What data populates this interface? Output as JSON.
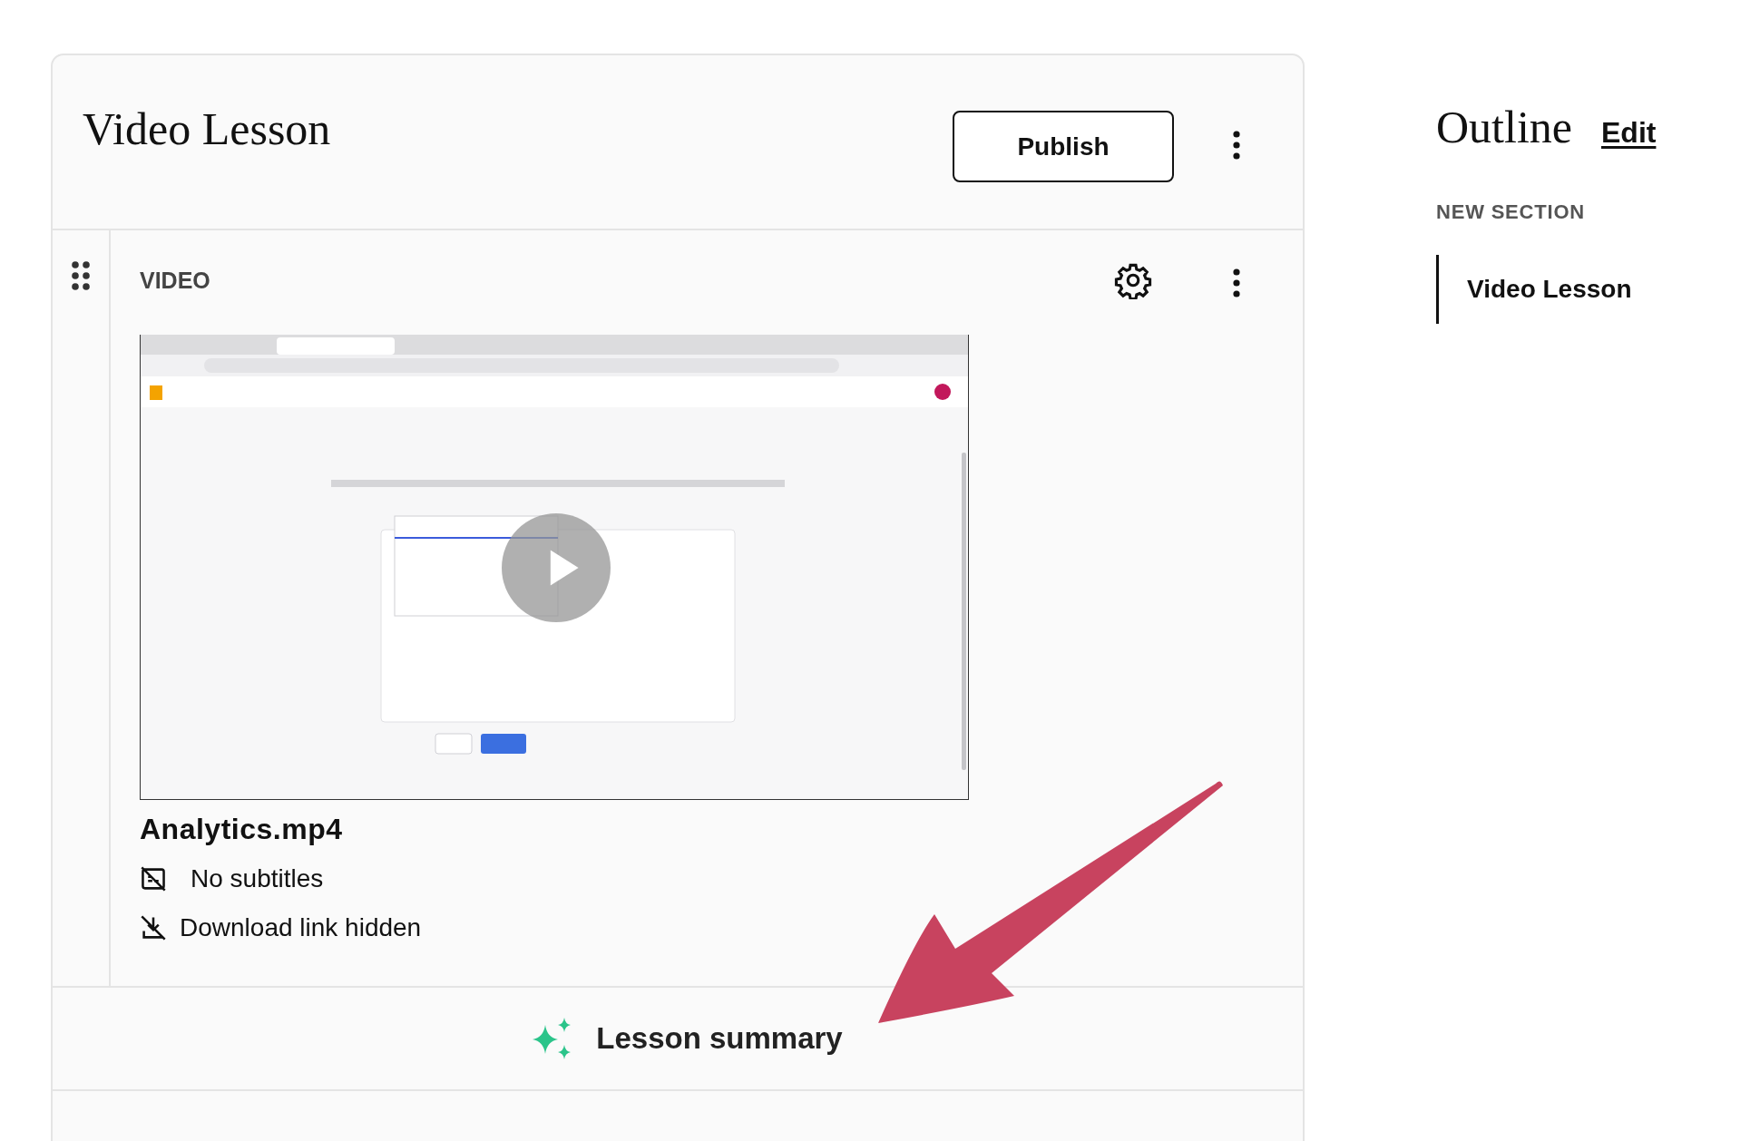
{
  "lesson": {
    "title": "Video Lesson",
    "publish_button": "Publish"
  },
  "block": {
    "type_label": "VIDEO",
    "video": {
      "kind": "picture",
      "file_name": "Analytics.mp4"
    },
    "details": [
      {
        "kind": "subtitles",
        "text": "No subtitles"
      },
      {
        "kind": "download",
        "text": "Download link hidden"
      }
    ]
  },
  "summary": {
    "label": "Lesson summary"
  },
  "outline": {
    "title": "Outline",
    "edit_link": "Edit",
    "section": "NEW SECTION",
    "items": [
      {
        "label": "Video Lesson",
        "selected": true
      }
    ]
  }
}
